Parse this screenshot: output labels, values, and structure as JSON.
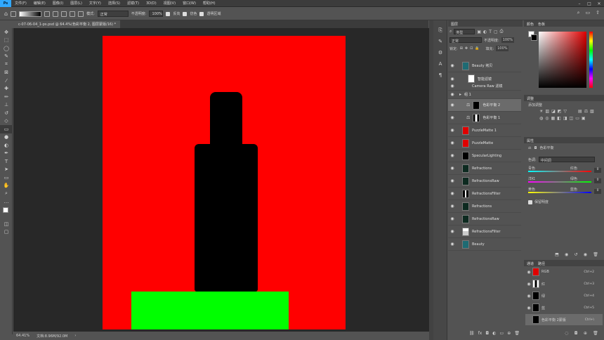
{
  "menu": {
    "logo": "Ps",
    "items": [
      "文件(F)",
      "编辑(E)",
      "图像(I)",
      "图层(L)",
      "文字(Y)",
      "选择(S)",
      "滤镜(T)",
      "3D(D)",
      "视图(V)",
      "窗口(W)",
      "帮助(H)"
    ]
  },
  "options": {
    "mode_label": "模式:",
    "mode_value": "正常",
    "opacity_label": "不透明度:",
    "opacity_value": "100%",
    "reverse": "反向",
    "dither": "仿色",
    "transparency": "透明区域"
  },
  "document": {
    "tab": "c-07-06-04_1-ps.psd @ 64.4%(色彩平衡 2, 图层蒙版/16) *",
    "zoom": "64.41%",
    "doc_size": "文档:8.96M/92.0M"
  },
  "colors": {
    "canvas_bg": "#ff0000",
    "bottle": "#000000",
    "base": "#00ff00"
  },
  "layers_panel": {
    "title": "图层",
    "filter_kind": "类型",
    "blend": "正常",
    "opacity_label": "不透明度:",
    "opacity": "100%",
    "lock_label": "锁定:",
    "fill_label": "填充:",
    "fill": "100%",
    "items": [
      {
        "name": "Beauty 拷贝"
      },
      {
        "name": "智能滤镜"
      },
      {
        "name": "Camera Raw 滤镜"
      },
      {
        "name": "组 1"
      },
      {
        "name": "色彩平衡 2"
      },
      {
        "name": "色彩平衡 1"
      },
      {
        "name": "PuzzleMatte 1"
      },
      {
        "name": "PuzzleMatte"
      },
      {
        "name": "SpecularLighting"
      },
      {
        "name": "Refractions"
      },
      {
        "name": "RefractionsRaw"
      },
      {
        "name": "RefractionsFilter"
      },
      {
        "name": "Refractions"
      },
      {
        "name": "RefractionsRaw"
      },
      {
        "name": "RefractionsFilter"
      },
      {
        "name": "Beauty"
      }
    ]
  },
  "color_panel": {
    "tab1": "颜色",
    "tab2": "色板"
  },
  "adjust_panel": {
    "title": "调整",
    "subtitle": "添加调整"
  },
  "props_panel": {
    "title": "属性",
    "type": "色彩平衡",
    "tone_label": "色调:",
    "tone": "中间调",
    "sliders": [
      {
        "left": "青色",
        "right": "红色",
        "value": "0"
      },
      {
        "left": "洋红",
        "right": "绿色",
        "value": "0"
      },
      {
        "left": "黄色",
        "right": "蓝色",
        "value": "0"
      }
    ],
    "preserve": "保留明度"
  },
  "channels": {
    "tab1": "通道",
    "tab2": "路径",
    "items": [
      {
        "name": "RGB",
        "shortcut": "Ctrl+2"
      },
      {
        "name": "红",
        "shortcut": "Ctrl+3"
      },
      {
        "name": "绿",
        "shortcut": "Ctrl+4"
      },
      {
        "name": "蓝",
        "shortcut": "Ctrl+5"
      },
      {
        "name": "色彩平衡 2蒙版",
        "shortcut": "Ctrl+\\"
      }
    ]
  }
}
